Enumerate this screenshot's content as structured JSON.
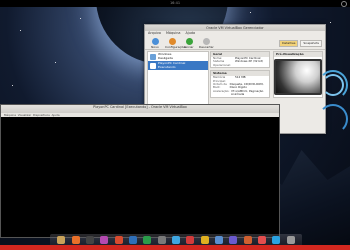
{
  "topbar": {
    "clock": "16:41"
  },
  "vbox": {
    "title": "Oracle VM VirtualBox Gerenciador",
    "menu": [
      "Arquivo",
      "Máquina",
      "Ajuda"
    ],
    "toolbar": [
      "Novo",
      "Configurações",
      "Iniciar",
      "Descartar"
    ],
    "segments": [
      "Detalhes",
      "Snapshots"
    ],
    "vms": [
      {
        "name": "Windows",
        "state": "Desligada"
      },
      {
        "name": "PlayonPC Cardinal",
        "state": "Executando"
      }
    ],
    "sections": {
      "geral": {
        "title": "Geral",
        "rows": [
          {
            "k": "Nome:",
            "v": "PlayonPC Cardinal"
          },
          {
            "k": "Sistema Operacional:",
            "v": "Windows XP (32 bit)"
          }
        ]
      },
      "sistema": {
        "title": "Sistema",
        "rows": [
          {
            "k": "Memória Principal:",
            "v": "512 MB"
          },
          {
            "k": "Ordem de Boot:",
            "v": "Disquete, CD/DVD-ROM, Disco Rígido"
          },
          {
            "k": "Aceleração:",
            "v": "VT-x/AMD-V, Paginação Aninhada"
          }
        ]
      },
      "preview_title": "Pré-Visualização"
    }
  },
  "terminal": {
    "title": "PlayonPC Cardinal [Executando] - Oracle VM VirtualBox",
    "menu": [
      "Máquina",
      "Visualizar",
      "Dispositivos",
      "Ajuda"
    ]
  },
  "dock": {
    "icons": [
      {
        "name": "home-folder",
        "color": "#c9a25a"
      },
      {
        "name": "web-browser",
        "color": "#e8702a"
      },
      {
        "name": "terminal",
        "color": "#444444"
      },
      {
        "name": "music",
        "color": "#b44ab0"
      },
      {
        "name": "mail",
        "color": "#d84b2f"
      },
      {
        "name": "virtualbox",
        "color": "#2f6fb8"
      },
      {
        "name": "office",
        "color": "#2a9c4a"
      },
      {
        "name": "settings",
        "color": "#7a7a7a"
      },
      {
        "name": "chat",
        "color": "#3fa6e0"
      },
      {
        "name": "photos",
        "color": "#d23b3b"
      },
      {
        "name": "chrome",
        "color": "#e0b020"
      },
      {
        "name": "files",
        "color": "#5a8fd0"
      },
      {
        "name": "editor",
        "color": "#6b5acd"
      },
      {
        "name": "video",
        "color": "#d06030"
      },
      {
        "name": "store",
        "color": "#e24e4e"
      },
      {
        "name": "skype",
        "color": "#2aa2e0"
      },
      {
        "name": "trash",
        "color": "#9a9a9a"
      }
    ]
  },
  "colors": {
    "accent": "#3a78c4",
    "redbar": "#d3271f"
  }
}
